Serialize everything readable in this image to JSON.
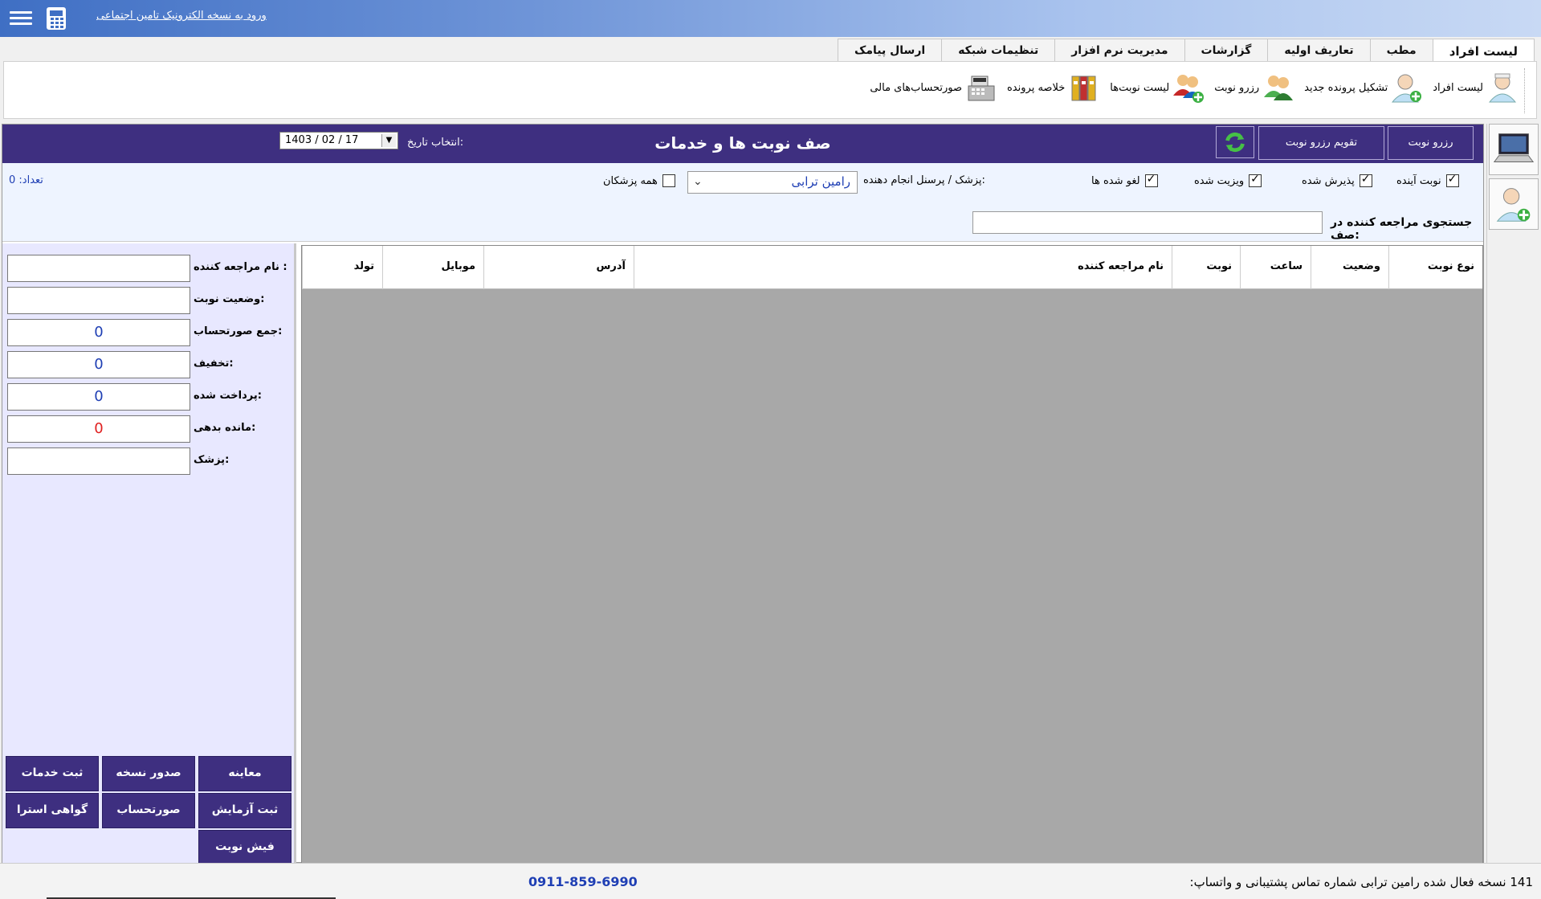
{
  "titlebar": {
    "link": "ورود به نسخه الکترونیک تامین اجتماعی"
  },
  "tabs": [
    "لیست افراد",
    "مطب",
    "تعاریف اولیه",
    "گزارشات",
    "مدیریت نرم افزار",
    "تنظیمات شبکه",
    "ارسال پیامک"
  ],
  "ribbon": {
    "items": [
      {
        "label": "لیست افراد",
        "icon": "person-list-icon"
      },
      {
        "label": "تشکیل پرونده جدید",
        "icon": "add-person-icon"
      },
      {
        "label": "رزرو نوبت",
        "icon": "reserve-users-icon"
      },
      {
        "label": "لیست نوبت‌ها",
        "icon": "appointments-list-icon"
      },
      {
        "label": "خلاصه پرونده",
        "icon": "file-binders-icon"
      },
      {
        "label": "صورتحساب‌های مالی",
        "icon": "cash-register-icon"
      }
    ]
  },
  "header": {
    "title": "صف نوبت ها و خدمات",
    "reserve_btn": "رزرو نوبت",
    "calendar_btn": "تقویم رزرو نوبت",
    "date_label": "انتخاب تاریخ:",
    "date_value": "1403 / 02 / 17"
  },
  "filters": {
    "upcoming": "نوبت آینده",
    "admitted": "پذیرش شده",
    "visited": "ویزیت شده",
    "cancelled": "لغو شده ها",
    "doctor_label": "پزشک / پرسنل انجام دهنده:",
    "doctor_value": "رامین ترابی",
    "all_doctors": "همه پزشکان",
    "count": "تعداد: 0",
    "search_label": "جستجوی مراجعه کننده در صف:"
  },
  "table": {
    "columns": [
      "نوع نوبت",
      "وضعیت",
      "ساعت",
      "نوبت",
      "نام مراجعه کننده",
      "آدرس",
      "موبایل",
      "تولد"
    ]
  },
  "info": {
    "name_label": "نام مراجعه کننده :",
    "status_label": "وضعیت نوبت:",
    "total_label": "جمع صورتحساب:",
    "total_value": "0",
    "discount_label": "تخفیف:",
    "discount_value": "0",
    "paid_label": "پرداخت شده:",
    "paid_value": "0",
    "debt_label": "مانده بدهی:",
    "debt_value": "0",
    "doctor_label": "پزشک:"
  },
  "actions": {
    "exam": "معاینه",
    "prescription": "صدور نسخه",
    "services": "ثبت خدمات",
    "lab": "ثبت آزمایش",
    "invoice": "صورتحساب",
    "rest_cert": "گواهی استرا",
    "receipt": "فیش نوبت"
  },
  "status": {
    "text": "141  نسخه فعال شده  رامین ترابی  شماره تماس پشتیبانی و واتساپ:",
    "phone": "0911-859-6990"
  },
  "colors": {
    "header": "#3e2f80",
    "titlebar_start": "#3f6fc4",
    "grid_bg": "#a8a8a8",
    "link_blue": "#1f3fb4",
    "debt_red": "#e02020"
  }
}
